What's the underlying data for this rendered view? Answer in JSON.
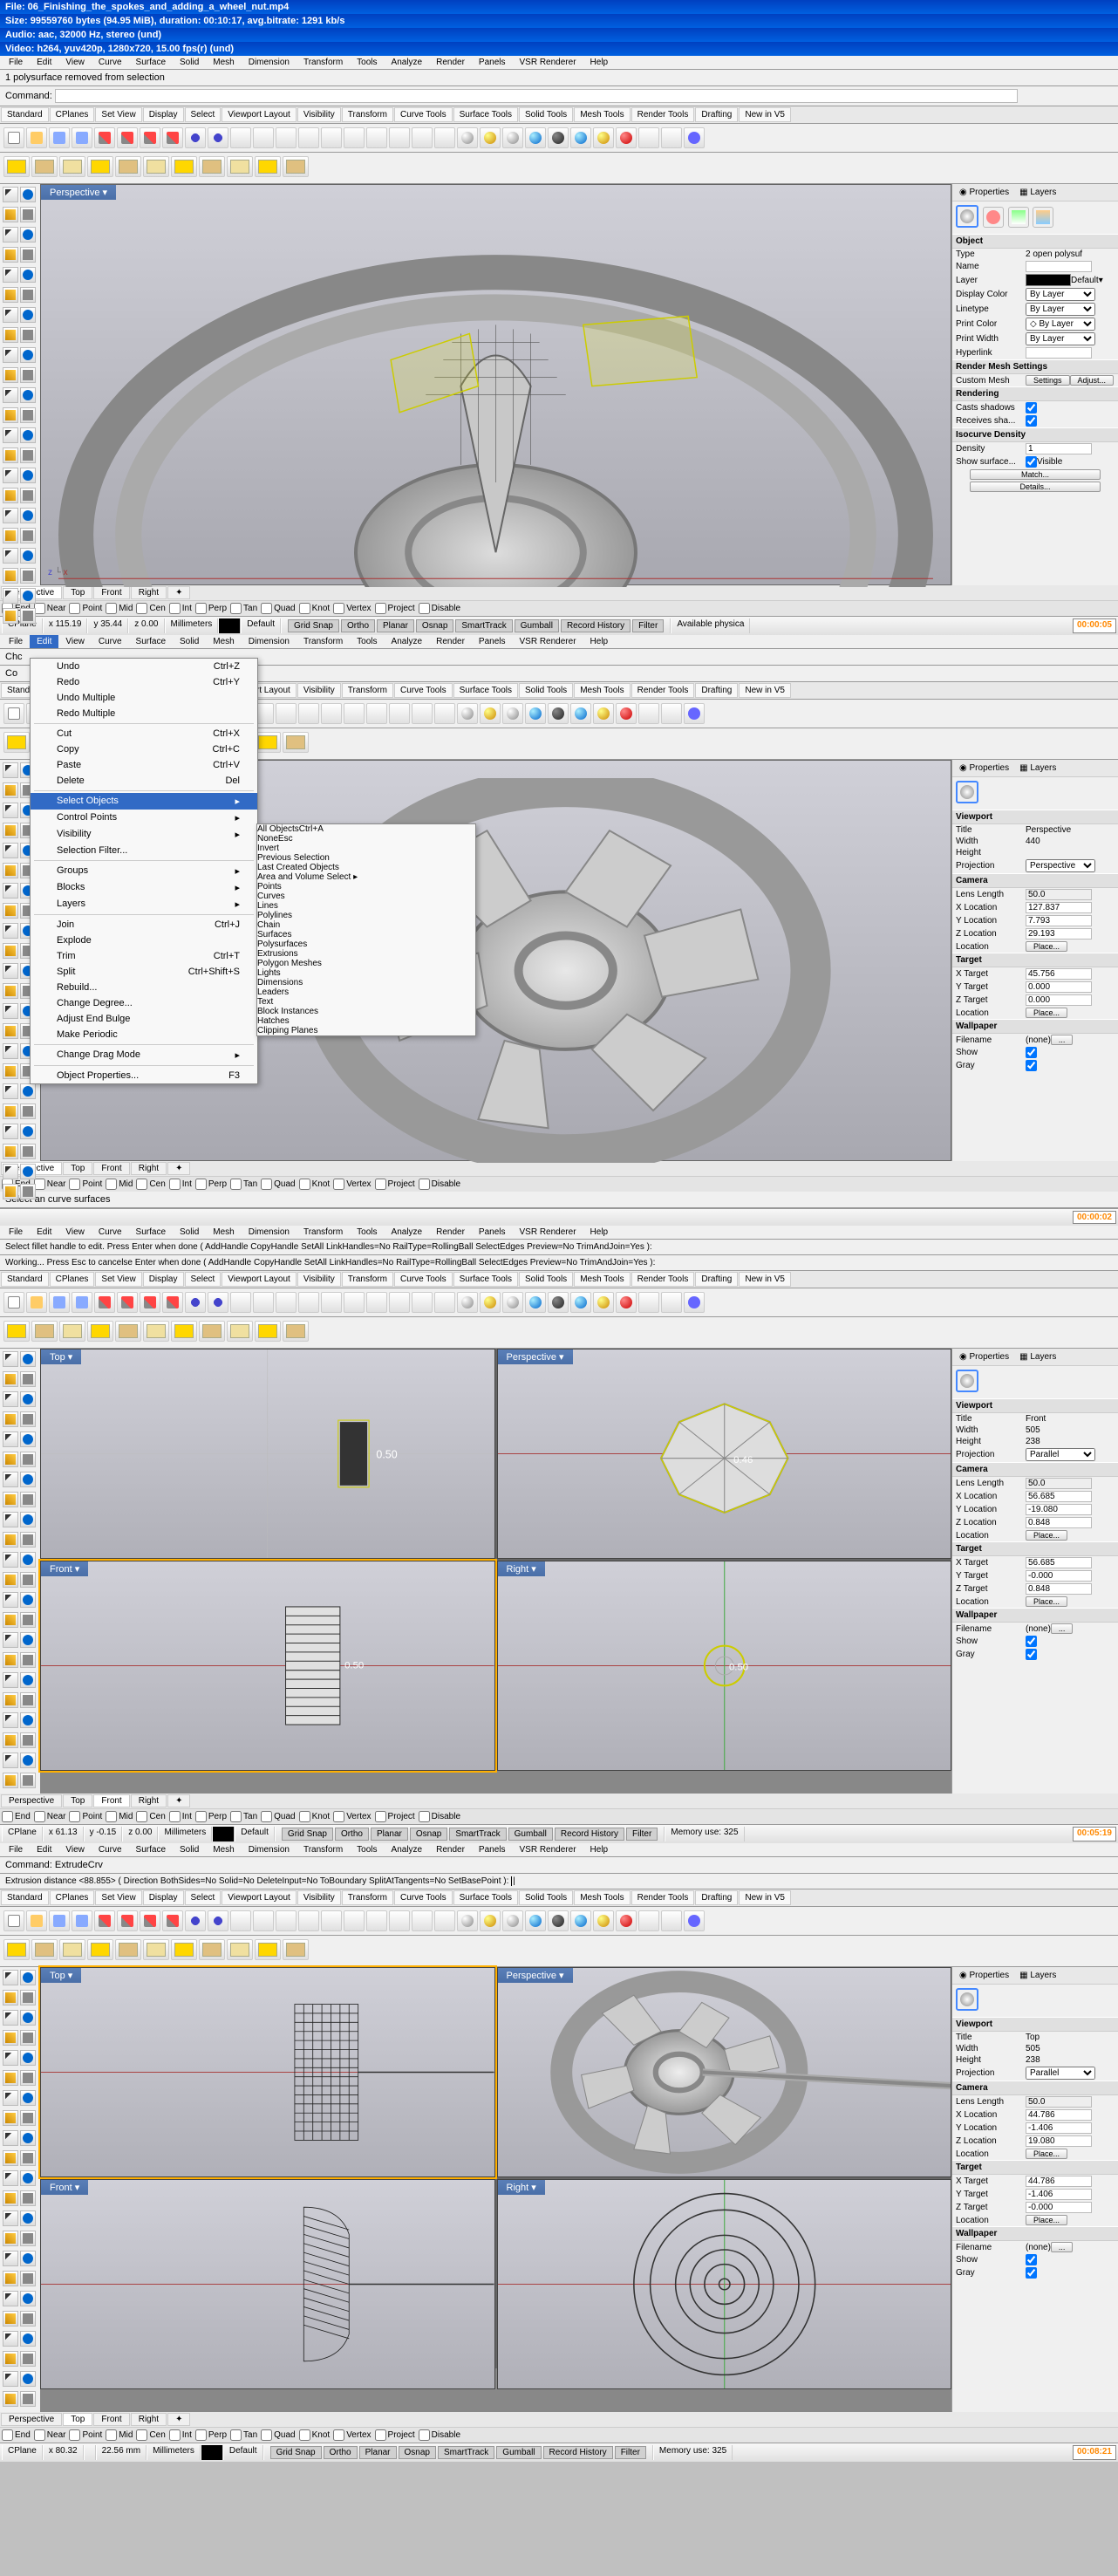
{
  "header": {
    "file": "File: 06_Finishing_the_spokes_and_adding_a_wheel_nut.mp4",
    "size": "Size: 99559760 bytes (94.95 MiB), duration: 00:10:17, avg.bitrate: 1291 kb/s",
    "audio": "Audio: aac, 32000 Hz, stereo (und)",
    "video": "Video: h264, yuv420p, 1280x720, 15.00 fps(r) (und)"
  },
  "menus": [
    "File",
    "Edit",
    "View",
    "Curve",
    "Surface",
    "Solid",
    "Mesh",
    "Dimension",
    "Transform",
    "Tools",
    "Analyze",
    "Render",
    "Panels",
    "VSR Renderer",
    "Help"
  ],
  "ecmenus": [
    "File",
    "Edit",
    "View",
    "Curve",
    "Surface",
    "Solid",
    "Mesh",
    "Dimension",
    "Transform",
    "Tools",
    "Analyze",
    "Render",
    "Panels",
    "VSR Renderer",
    "Help"
  ],
  "tabs": [
    "Standard",
    "CPlanes",
    "Set View",
    "Display",
    "Select",
    "Viewport Layout",
    "Visibility",
    "Transform",
    "Curve Tools",
    "Surface Tools",
    "Solid Tools",
    "Mesh Tools",
    "Render Tools",
    "Drafting",
    "New in V5"
  ],
  "osnap": {
    "items": [
      "End",
      "Near",
      "Point",
      "Mid",
      "Cen",
      "Int",
      "Perp",
      "Tan",
      "Quad",
      "Knot",
      "Vertex",
      "Project",
      "Disable"
    ]
  },
  "vptabs": [
    "Perspective",
    "Top",
    "Front",
    "Right",
    "✦"
  ],
  "shot1": {
    "cmdout": "1 polysurface removed from selection",
    "cmdlabel": "Command:",
    "vpname": "Perspective ▾",
    "status": {
      "cplane": "CPlane",
      "x": "x 115.19",
      "y": "y 35.44",
      "z": "z 0.00",
      "units": "Millimeters",
      "layer": "Default",
      "btns": [
        "Grid Snap",
        "Ortho",
        "Planar",
        "Osnap",
        "SmartTrack",
        "Gumball",
        "Record History",
        "Filter"
      ],
      "mem": "Available physica",
      "ts": "00:00:05"
    },
    "props": {
      "tabProps": "◉ Properties",
      "tabLayers": "▦ Layers",
      "secObj": "Object",
      "type": "Type",
      "typeV": "2 open polysuf",
      "name": "Name",
      "layer": "Layer",
      "layerV": "Default",
      "dispColor": "Display Color",
      "byLayer": "By Layer",
      "linetype": "Linetype",
      "printColor": "Print Color",
      "printWidth": "Print Width",
      "hyperlink": "Hyperlink",
      "secRMesh": "Render Mesh Settings",
      "customMesh": "Custom Mesh",
      "settings": "Settings",
      "adjust": "Adjust...",
      "secRend": "Rendering",
      "castShad": "Casts shadows",
      "recvShad": "Receives sha...",
      "secIso": "Isocurve Density",
      "density": "Density",
      "densityV": "1",
      "showSurf": "Show surface...",
      "visible": "Visible",
      "match": "Match...",
      "details": "Details..."
    }
  },
  "shot2": {
    "cmdout": "Chc",
    "cmdlabel": "Co",
    "vpname": "Pers",
    "status": {
      "ts": "00:00:02"
    },
    "edit": {
      "items": [
        {
          "t": "Undo",
          "k": "Ctrl+Z"
        },
        {
          "t": "Redo",
          "k": "Ctrl+Y"
        },
        {
          "t": "Undo Multiple",
          "k": ""
        },
        {
          "t": "Redo Multiple",
          "k": ""
        },
        {
          "sep": 1
        },
        {
          "t": "Cut",
          "k": "Ctrl+X"
        },
        {
          "t": "Copy",
          "k": "Ctrl+C"
        },
        {
          "t": "Paste",
          "k": "Ctrl+V"
        },
        {
          "t": "Delete",
          "k": "Del"
        },
        {
          "sep": 1
        },
        {
          "t": "Select Objects",
          "k": "",
          "arrow": 1,
          "hl": 1
        },
        {
          "t": "Control Points",
          "k": "",
          "arrow": 1
        },
        {
          "t": "Visibility",
          "k": "",
          "arrow": 1
        },
        {
          "t": "Selection Filter...",
          "k": ""
        },
        {
          "sep": 1
        },
        {
          "t": "Groups",
          "k": "",
          "arrow": 1
        },
        {
          "t": "Blocks",
          "k": "",
          "arrow": 1
        },
        {
          "t": "Layers",
          "k": "",
          "arrow": 1
        },
        {
          "sep": 1
        },
        {
          "t": "Join",
          "k": "Ctrl+J"
        },
        {
          "t": "Explode",
          "k": ""
        },
        {
          "t": "Trim",
          "k": "Ctrl+T"
        },
        {
          "t": "Split",
          "k": "Ctrl+Shift+S"
        },
        {
          "t": "Rebuild...",
          "k": ""
        },
        {
          "t": "Change Degree...",
          "k": ""
        },
        {
          "t": "Adjust End Bulge",
          "k": ""
        },
        {
          "t": "Make Periodic",
          "k": ""
        },
        {
          "sep": 1
        },
        {
          "t": "Change Drag Mode",
          "k": "",
          "arrow": 1
        },
        {
          "sep": 1
        },
        {
          "t": "Object Properties...",
          "k": "F3"
        }
      ]
    },
    "sub": {
      "items": [
        {
          "t": "All Objects",
          "k": "Ctrl+A"
        },
        {
          "t": "None",
          "k": "Esc"
        },
        {
          "t": "Invert",
          "k": ""
        },
        {
          "t": "Previous Selection",
          "k": ""
        },
        {
          "t": "Last Created Objects",
          "k": ""
        },
        {
          "t": "Area and Volume Select",
          "k": "",
          "arrow": 1
        },
        {
          "sep": 1
        },
        {
          "t": "Points",
          "k": ""
        },
        {
          "t": "Curves",
          "k": "",
          "hl": 1
        },
        {
          "t": "Lines",
          "k": ""
        },
        {
          "t": "Polylines",
          "k": ""
        },
        {
          "t": "Chain",
          "k": ""
        },
        {
          "sep": 1
        },
        {
          "t": "Surfaces",
          "k": ""
        },
        {
          "t": "Polysurfaces",
          "k": ""
        },
        {
          "t": "Extrusions",
          "k": ""
        },
        {
          "t": "Polygon Meshes",
          "k": ""
        },
        {
          "sep": 1
        },
        {
          "t": "Lights",
          "k": ""
        },
        {
          "t": "Dimensions",
          "k": ""
        },
        {
          "t": "Leaders",
          "k": ""
        },
        {
          "t": "Text",
          "k": ""
        },
        {
          "sep": 1
        },
        {
          "t": "Block Instances",
          "k": ""
        },
        {
          "t": "Hatches",
          "k": ""
        },
        {
          "sep": 1
        },
        {
          "t": "Clipping Planes",
          "k": ""
        }
      ]
    },
    "cmdtail": "Select an curve surfaces",
    "props": {
      "secVp": "Viewport",
      "title": "Title",
      "titleV": "Perspective",
      "width": "Width",
      "widthV": "440",
      "height": "Height",
      "proj": "Projection",
      "projV": "Perspective",
      "secCam": "Camera",
      "lens": "Lens Length",
      "lensV": "50.0",
      "xloc": "X Location",
      "xlocV": "127.837",
      "yloc": "Y Location",
      "ylocV": "7.793",
      "zloc": "Z Location",
      "zlocV": "29.193",
      "loc": "Location",
      "place": "Place...",
      "secTar": "Target",
      "xtar": "X Target",
      "xtarV": "45.756",
      "ytar": "Y Target",
      "ytarV": "0.000",
      "ztar": "Z Target",
      "ztarV": "0.000",
      "secWall": "Wallpaper",
      "fname": "Filename",
      "fnameV": "(none)",
      "show": "Show",
      "gray": "Gray"
    }
  },
  "shot3": {
    "cmd1": "Working... Press Esc to cancelse Enter when done ( AddHandle CopyHandle SetAll LinkHandles=No RailType=RollingBall SelectEdges Preview=No TrimAndJoin=Yes ):",
    "cmd2": "Select fillet handle to edit. Press Enter when done ( AddHandle CopyHandle SetAll LinkHandles=No RailType=RollingBall SelectEdges Preview=No TrimAndJoin=Yes ):",
    "vTop": "Top ▾",
    "vPersp": "Perspective ▾",
    "vFront": "Front ▾",
    "vRight": "Right ▾",
    "status": {
      "x": "x 61.13",
      "y": "y -0.15",
      "z": "z 0.00",
      "mem": "Memory use: 325",
      "ts": "00:05:19"
    },
    "props": {
      "secVp": "Viewport",
      "title": "Title",
      "titleV": "Front",
      "width": "Width",
      "widthV": "505",
      "height": "Height",
      "heightV": "238",
      "proj": "Projection",
      "projV": "Parallel",
      "secCam": "Camera",
      "lens": "Lens Length",
      "lensV": "50.0",
      "xloc": "X Location",
      "xlocV": "56.685",
      "yloc": "Y Location",
      "ylocV": "-19.080",
      "zloc": "Z Location",
      "zlocV": "0.848",
      "loc": "Location",
      "place": "Place...",
      "secTar": "Target",
      "xtar": "X Target",
      "xtarV": "56.685",
      "ytar": "Y Target",
      "ytarV": "-0.000",
      "ztar": "Z Target",
      "ztarV": "0.848",
      "secWall": "Wallpaper",
      "fname": "Filename",
      "fnameV": "(none)",
      "show": "Show",
      "gray": "Gray"
    },
    "dim1": "0.50",
    "dim2": "0.46",
    "dim3": "0.50",
    "dim4": "0.50"
  },
  "shot4": {
    "cmdlabel": "Command: ExtrudeCrv",
    "cmd": "Extrusion distance <88.855> ( Direction BothSides=No Solid=No DeleteInput=No ToBoundary SplitAtTangents=No SetBasePoint ):",
    "status": {
      "x": "x 80.32",
      "y": "",
      "z": "22.56 mm",
      "mem": "Memory use: 325",
      "ts": "00:08:21"
    },
    "props": {
      "secVp": "Viewport",
      "title": "Title",
      "titleV": "Top",
      "width": "Width",
      "widthV": "505",
      "height": "Height",
      "heightV": "238",
      "proj": "Projection",
      "projV": "Parallel",
      "secCam": "Camera",
      "lens": "Lens Length",
      "lensV": "50.0",
      "xloc": "X Location",
      "xlocV": "44.786",
      "yloc": "Y Location",
      "ylocV": "-1.406",
      "zloc": "Z Location",
      "zlocV": "19.080",
      "loc": "Location",
      "place": "Place...",
      "secTar": "Target",
      "xtar": "X Target",
      "xtarV": "44.786",
      "ytar": "Y Target",
      "ytarV": "-1.406",
      "ztar": "Z Target",
      "ztarV": "-0.000",
      "secWall": "Wallpaper",
      "fname": "Filename",
      "fnameV": "(none)",
      "show": "Show",
      "gray": "Gray"
    }
  }
}
